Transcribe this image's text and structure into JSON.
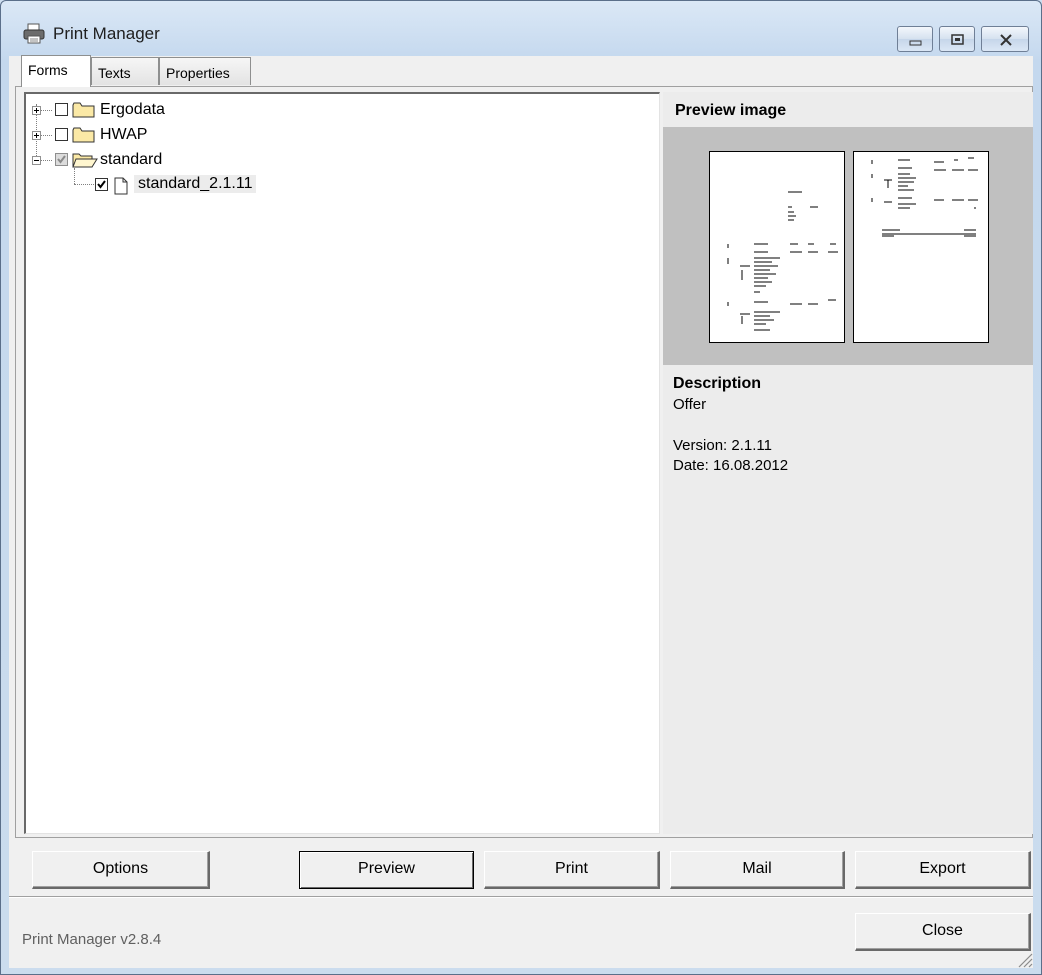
{
  "window": {
    "title": "Print Manager",
    "controls": [
      "minimize-icon",
      "restore-icon",
      "close-icon"
    ]
  },
  "tabs": [
    {
      "label": "Forms",
      "active": true
    },
    {
      "label": "Texts",
      "active": false
    },
    {
      "label": "Properties",
      "active": false
    }
  ],
  "tree": {
    "nodes": [
      {
        "label": "Ergodata",
        "checked": false,
        "expanded": false,
        "type": "folder"
      },
      {
        "label": "HWAP",
        "checked": false,
        "expanded": false,
        "type": "folder"
      },
      {
        "label": "standard",
        "checked": "partial",
        "expanded": true,
        "type": "open-folder"
      },
      {
        "label": "standard_2.1.11",
        "checked": true,
        "type": "document",
        "selected": true
      }
    ]
  },
  "preview": {
    "title": "Preview image",
    "description_title": "Description",
    "description": "Offer",
    "version": "Version: 2.1.11",
    "date": "Date: 16.08.2012"
  },
  "buttons": {
    "options": "Options",
    "preview": "Preview",
    "print": "Print",
    "mail": "Mail",
    "export": "Export",
    "close": "Close"
  },
  "status": {
    "version": "Print Manager v2.8.4"
  },
  "colors": {
    "title_bar": "#cfdff0",
    "preview_bg": "#c0c0c0",
    "folder": "#f5d97a"
  }
}
